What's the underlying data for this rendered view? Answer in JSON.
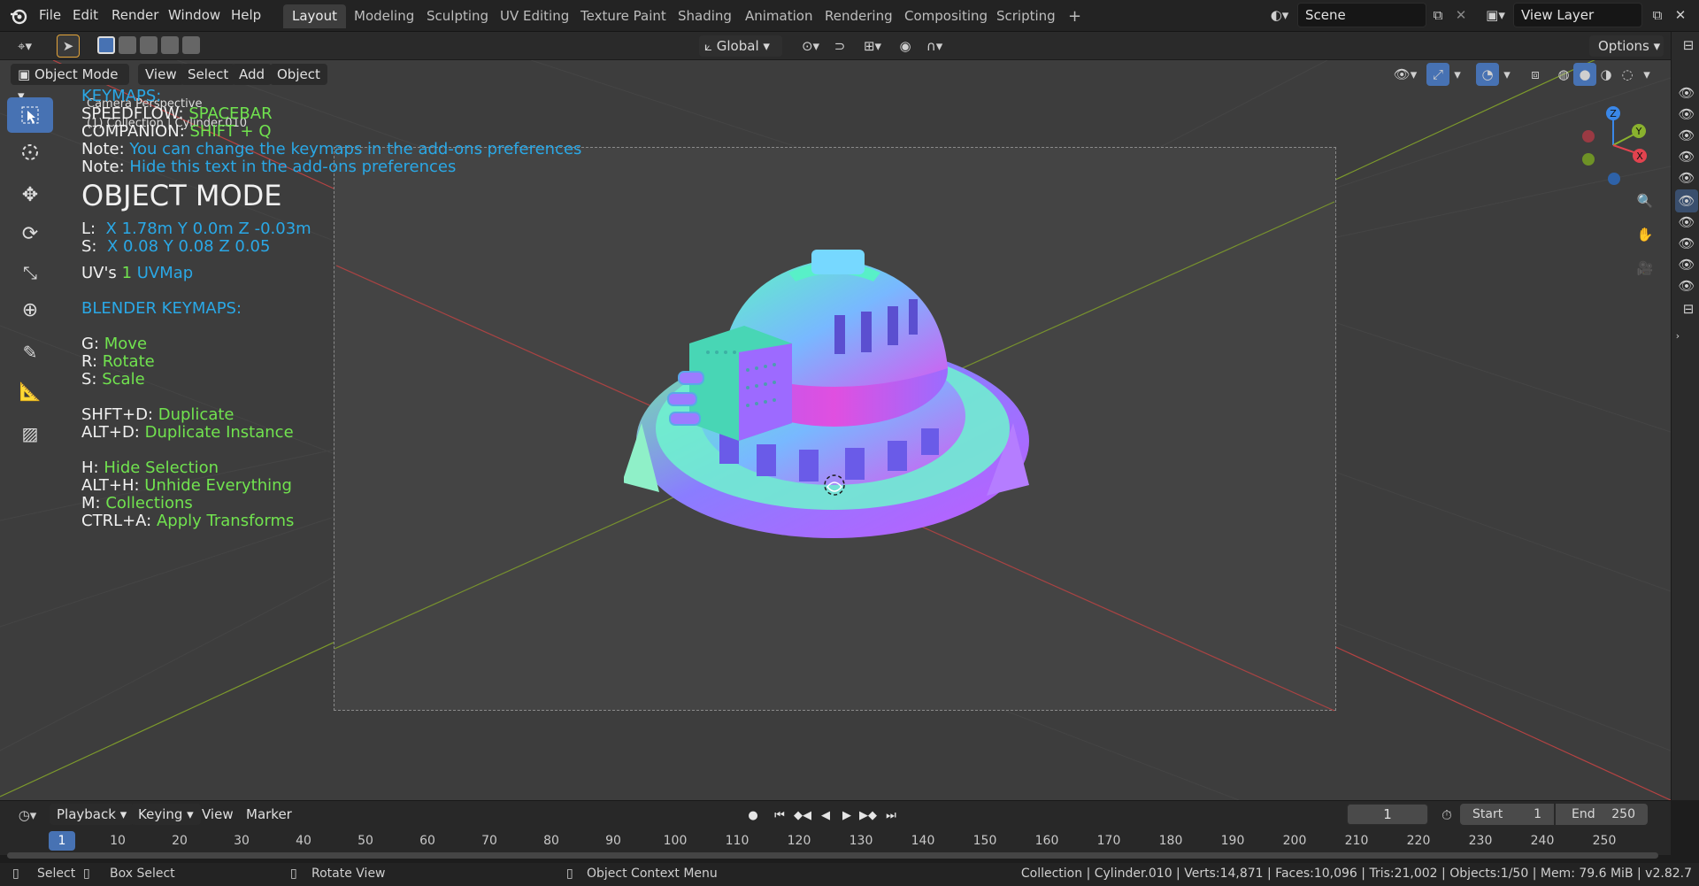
{
  "topbar": {
    "menus": [
      "File",
      "Edit",
      "Render",
      "Window",
      "Help"
    ],
    "workspaces": [
      "Layout",
      "Modeling",
      "Sculpting",
      "UV Editing",
      "Texture Paint",
      "Shading",
      "Animation",
      "Rendering",
      "Compositing",
      "Scripting"
    ],
    "active_workspace": "Layout",
    "add_tab": "+",
    "scene_name": "Scene",
    "view_layer": "View Layer"
  },
  "toolheader": {
    "orientation": "Global",
    "options": "Options"
  },
  "viewport_header": {
    "mode": "Object Mode",
    "menus": [
      "View",
      "Select",
      "Add",
      "Object"
    ]
  },
  "overlay": {
    "camera_label": "Camera Perspective",
    "collection_label": "(1) Collection | Cylinder.010",
    "keymaps_title": "KEYMAPS:",
    "speedflow_key": "SPEEDFLOW:",
    "speedflow_val": "SPACEBAR",
    "companion_key": "COMPANION:",
    "companion_val": "SHIFT + Q",
    "note1_key": "Note:",
    "note1_val": "You can change the keymaps in the add-ons preferences",
    "note2_key": "Note:",
    "note2_val": "Hide this text in the add-ons preferences",
    "mode_title": "OBJECT MODE",
    "loc_key": "L:",
    "loc_val": "X 1.78m Y 0.0m Z -0.03m",
    "scale_key": "S:",
    "scale_val": "X 0.08 Y 0.08 Z 0.05",
    "uv_key": "UV's",
    "uv_count": "1",
    "uv_name": "UVMap",
    "blender_keymaps": "BLENDER KEYMAPS:",
    "keys": [
      {
        "k": "G:",
        "v": "Move"
      },
      {
        "k": "R:",
        "v": "Rotate"
      },
      {
        "k": "S:",
        "v": "Scale"
      },
      {
        "k": "SHFT+D:",
        "v": "Duplicate"
      },
      {
        "k": "ALT+D:",
        "v": "Duplicate Instance"
      },
      {
        "k": "H:",
        "v": "Hide Selection"
      },
      {
        "k": "ALT+H:",
        "v": "Unhide Everything"
      },
      {
        "k": "M:",
        "v": "Collections"
      },
      {
        "k": "CTRL+A:",
        "v": "Apply Transforms"
      }
    ]
  },
  "gizmo": {
    "z": "Z",
    "y": "Y",
    "x": "X"
  },
  "timeline": {
    "menus": [
      "Playback",
      "Keying",
      "View",
      "Marker"
    ],
    "current_frame": "1",
    "start_label": "Start",
    "start": "1",
    "end_label": "End",
    "end": "250",
    "ticks": [
      "10",
      "20",
      "30",
      "40",
      "50",
      "60",
      "70",
      "80",
      "90",
      "100",
      "110",
      "120",
      "130",
      "140",
      "150",
      "160",
      "170",
      "180",
      "190",
      "200",
      "210",
      "220",
      "230",
      "240",
      "250"
    ]
  },
  "statusbar": {
    "select": "Select",
    "box_select": "Box Select",
    "rotate_view": "Rotate View",
    "context_menu": "Object Context Menu",
    "stats": "Collection | Cylinder.010 | Verts:14,871 | Faces:10,096 | Tris:21,002 | Objects:1/50 | Mem: 79.6 MiB | v2.82.7"
  },
  "colors": {
    "accent": "#4772b3",
    "overlay_blue": "#2aa8e6",
    "overlay_green": "#71e34f"
  }
}
